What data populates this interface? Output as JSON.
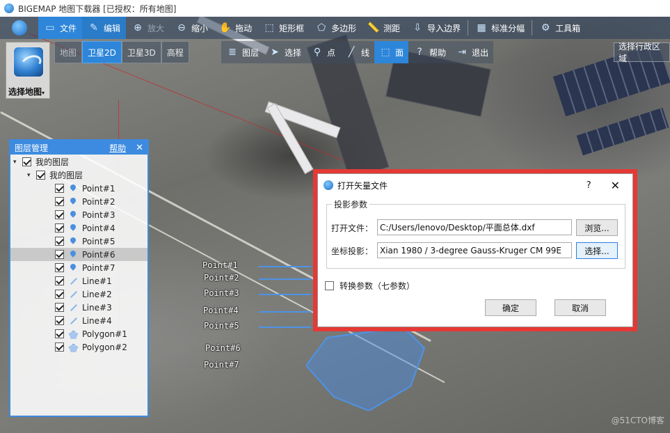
{
  "window": {
    "title": "BIGEMAP 地图下载器 [已授权：所有地图]"
  },
  "toolbar": {
    "items": [
      {
        "label": "文件",
        "icon": "folder-icon"
      },
      {
        "label": "编辑",
        "icon": "edit-icon"
      },
      {
        "label": "放大",
        "icon": "zoom-in-icon"
      },
      {
        "label": "缩小",
        "icon": "zoom-out-icon"
      },
      {
        "label": "拖动",
        "icon": "hand-icon"
      },
      {
        "label": "矩形框",
        "icon": "rectangle-icon"
      },
      {
        "label": "多边形",
        "icon": "polygon-icon"
      },
      {
        "label": "测距",
        "icon": "ruler-icon"
      },
      {
        "label": "导入边界",
        "icon": "import-icon"
      },
      {
        "label": "标准分幅",
        "icon": "grid-icon"
      },
      {
        "label": "工具箱",
        "icon": "gear-icon"
      }
    ]
  },
  "map_types": [
    {
      "label": "地图"
    },
    {
      "label": "卫星2D"
    },
    {
      "label": "卫星3D"
    },
    {
      "label": "高程"
    }
  ],
  "tools2": [
    {
      "label": "图层",
      "icon": "layers-icon"
    },
    {
      "label": "选择",
      "icon": "cursor-icon"
    },
    {
      "label": "点",
      "icon": "pin-icon"
    },
    {
      "label": "线",
      "icon": "line-icon"
    },
    {
      "label": "面",
      "icon": "area-icon"
    },
    {
      "label": "帮助",
      "icon": "help-icon"
    },
    {
      "label": "退出",
      "icon": "exit-icon"
    }
  ],
  "region_button": "选择行政区域",
  "select_map": {
    "label": "选择地图"
  },
  "layer_panel": {
    "title": "图层管理",
    "help": "帮助",
    "root": "我的图层",
    "group": "我的图层",
    "items": [
      {
        "label": "Point#1",
        "kind": "point"
      },
      {
        "label": "Point#2",
        "kind": "point"
      },
      {
        "label": "Point#3",
        "kind": "point"
      },
      {
        "label": "Point#4",
        "kind": "point"
      },
      {
        "label": "Point#5",
        "kind": "point"
      },
      {
        "label": "Point#6",
        "kind": "point"
      },
      {
        "label": "Point#7",
        "kind": "point"
      },
      {
        "label": "Line#1",
        "kind": "line"
      },
      {
        "label": "Line#2",
        "kind": "line"
      },
      {
        "label": "Line#3",
        "kind": "line"
      },
      {
        "label": "Line#4",
        "kind": "line"
      },
      {
        "label": "Polygon#1",
        "kind": "polygon"
      },
      {
        "label": "Polygon#2",
        "kind": "polygon"
      }
    ]
  },
  "map_labels": [
    "Point#1",
    "Point#2",
    "Point#3",
    "Point#4",
    "Point#5",
    "Point#6",
    "Point#7"
  ],
  "dialog": {
    "title": "打开矢量文件",
    "help": "?",
    "close": "✕",
    "group_title": "投影参数",
    "open_file_label": "打开文件：",
    "open_file_value": "C:/Users/lenovo/Desktop/平面总体.dxf",
    "browse": "浏览...",
    "projection_label": "坐标投影：",
    "projection_value": "Xian 1980 / 3-degree Gauss-Kruger CM 99E",
    "select": "选择...",
    "convert_label": "转换参数（七参数）",
    "ok": "确定",
    "cancel": "取消"
  },
  "watermark": "@51CTO博客",
  "colors": {
    "accent": "#2d86d9",
    "highlight": "#e53935"
  }
}
